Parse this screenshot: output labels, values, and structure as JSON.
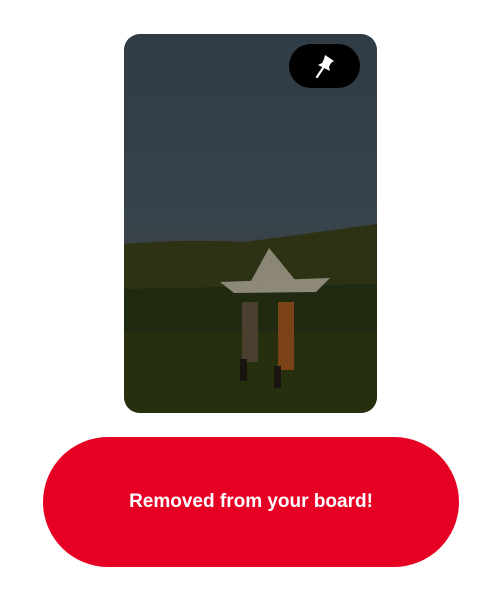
{
  "pin": {
    "image_description_icon": "photo",
    "pin_icon": "pushpin-icon"
  },
  "toast": {
    "message": "Removed from your board!",
    "color": "#e60023"
  }
}
